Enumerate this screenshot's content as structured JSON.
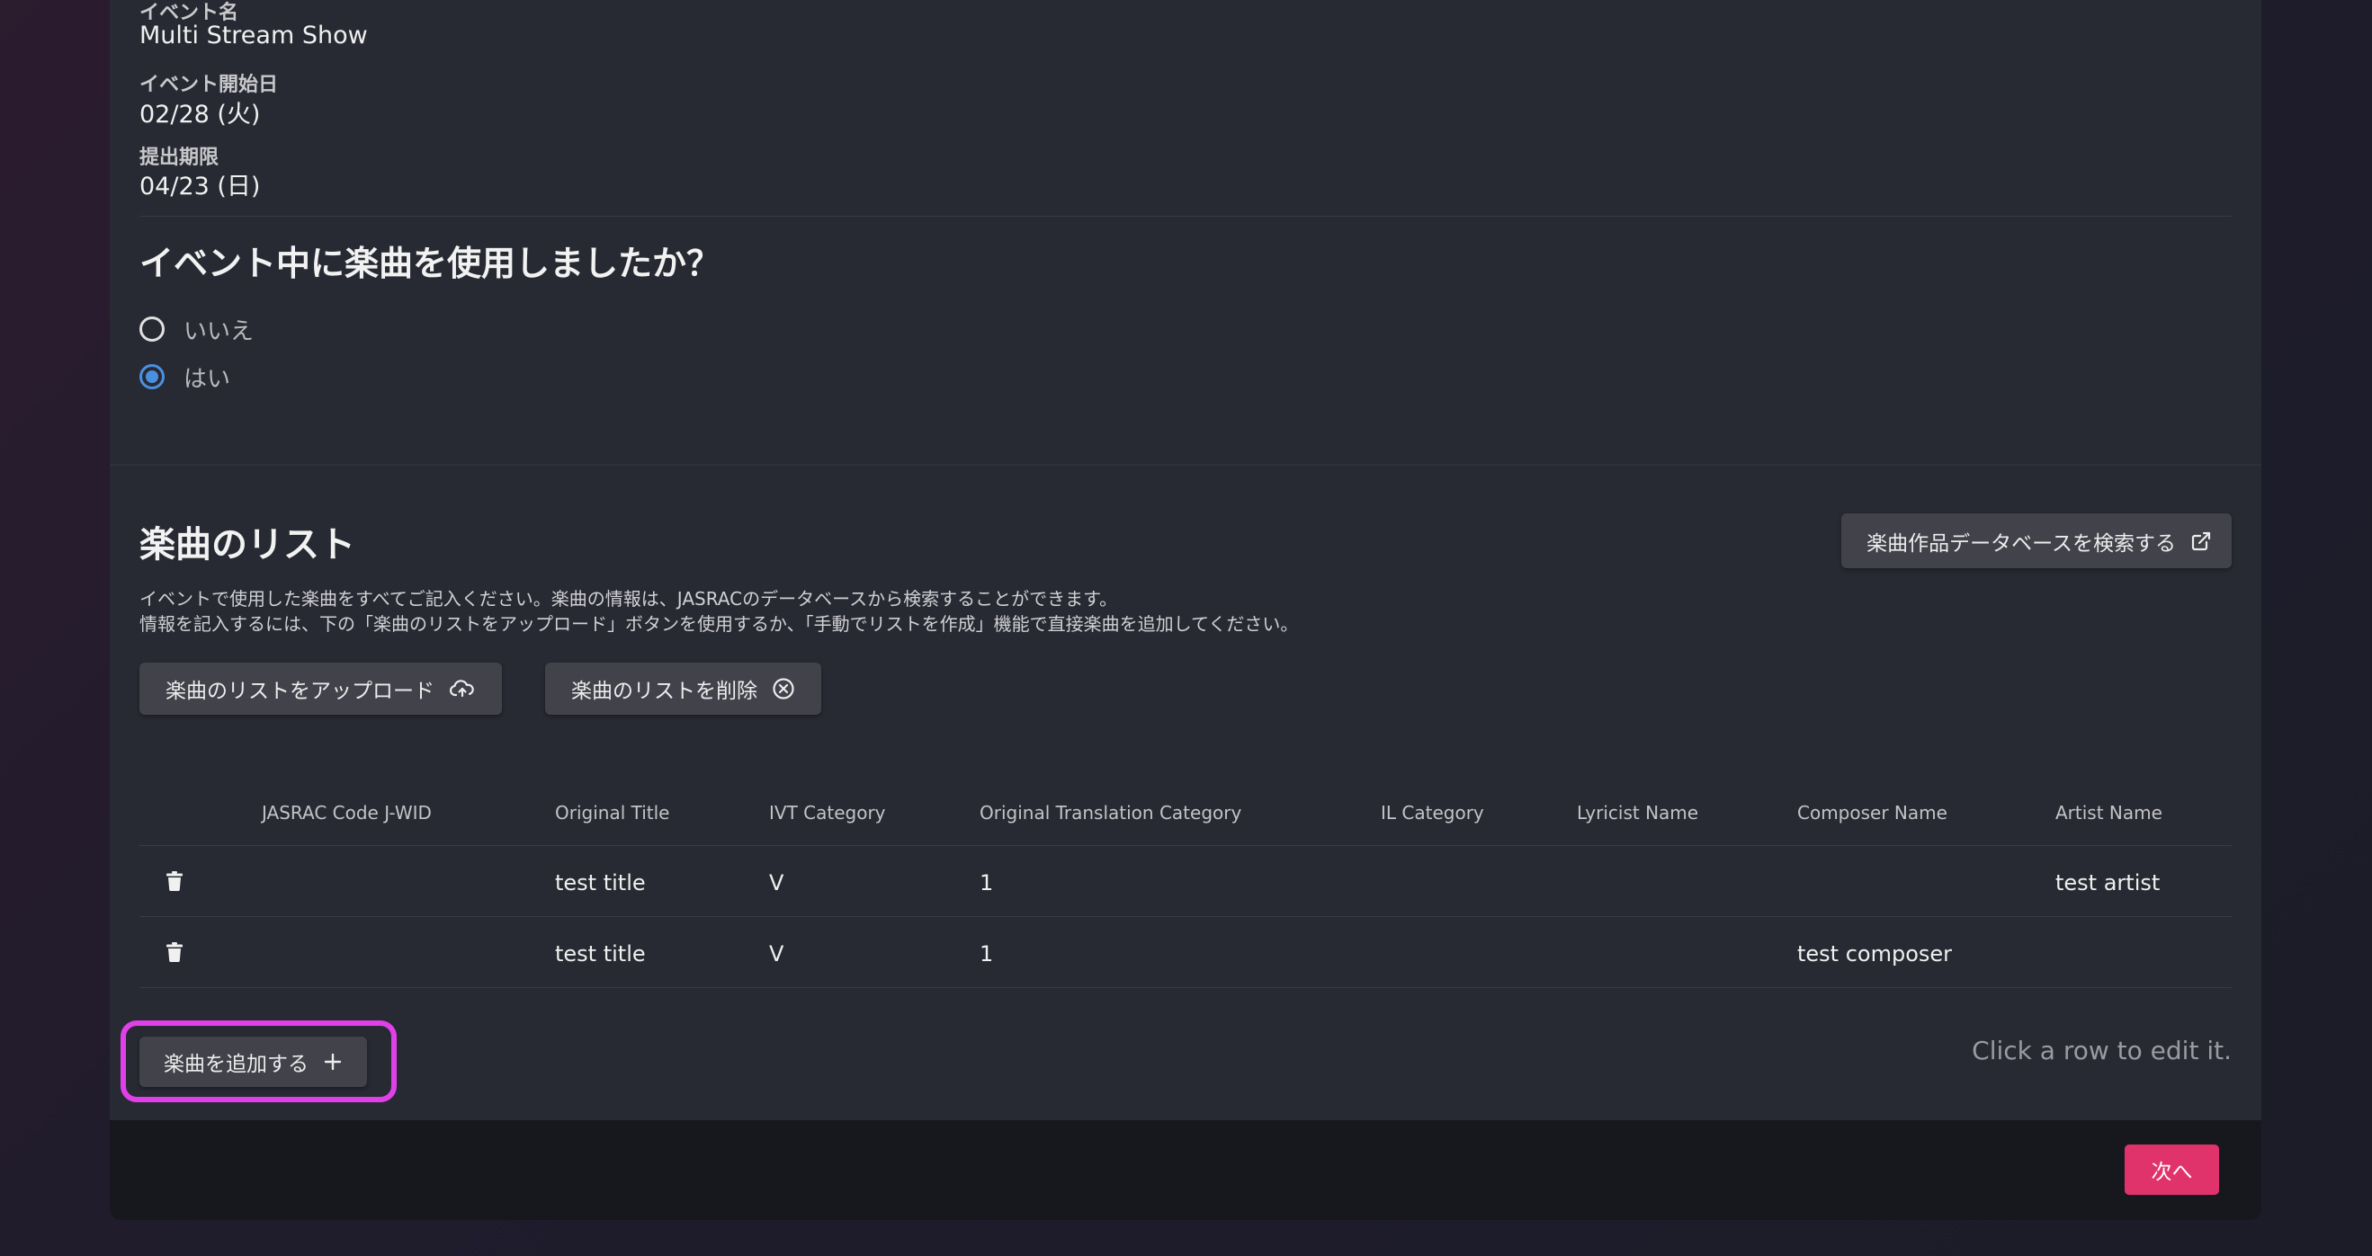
{
  "event": {
    "name_label": "イベント名",
    "name_value": "Multi Stream Show",
    "start_label": "イベント開始日",
    "start_value": "02/28 (火)",
    "deadline_label": "提出期限",
    "deadline_value": "04/23 (日)"
  },
  "music_question": {
    "title": "イベント中に楽曲を使用しましたか？",
    "options": [
      {
        "label": "いいえ",
        "checked": false
      },
      {
        "label": "はい",
        "checked": true
      }
    ]
  },
  "song_list": {
    "title": "楽曲のリスト",
    "search_db_button": "楽曲作品データベースを検索する",
    "description_line1": "イベントで使用した楽曲をすべてご記入ください。楽曲の情報は、JASRACのデータベースから検索することができます。",
    "description_line2": "情報を記入するには、下の「楽曲のリストをアップロード」ボタンを使用するか、「手動でリストを作成」機能で直接楽曲を追加してください。",
    "upload_button": "楽曲のリストをアップロード",
    "delete_button": "楽曲のリストを削除",
    "columns": [
      "JASRAC Code J-WID",
      "Original Title",
      "IVT Category",
      "Original Translation Category",
      "IL Category",
      "Lyricist Name",
      "Composer Name",
      "Artist Name"
    ],
    "rows": [
      {
        "jwid": "",
        "title": "test title",
        "ivt": "V",
        "translation": "1",
        "il": "",
        "lyricist": "",
        "composer": "",
        "artist": "test artist"
      },
      {
        "jwid": "",
        "title": "test title",
        "ivt": "V",
        "translation": "1",
        "il": "",
        "lyricist": "",
        "composer": "test composer",
        "artist": ""
      }
    ],
    "add_button": "楽曲を追加する",
    "edit_hint": "Click a row to edit it."
  },
  "footer": {
    "next_button": "次へ"
  },
  "colors": {
    "accent_radio": "#4a90e2",
    "next_button": "#e0336b",
    "highlight": "#e040e8"
  },
  "icons": {
    "external_link": "external-link-icon",
    "upload": "cloud-upload-icon",
    "delete": "circle-x-icon",
    "trash": "trash-icon",
    "plus": "plus-icon"
  }
}
